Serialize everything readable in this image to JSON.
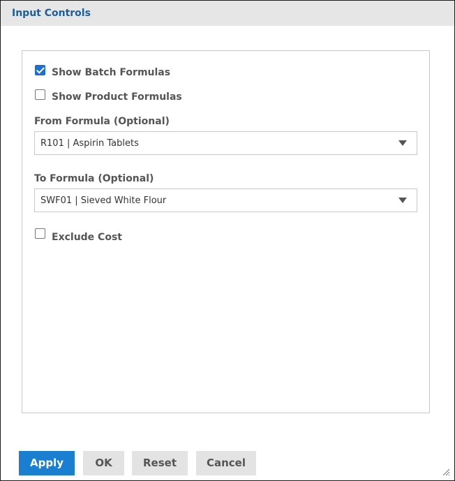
{
  "dialog": {
    "title": "Input Controls"
  },
  "controls": {
    "show_batch_formulas": {
      "label": "Show Batch Formulas",
      "checked": true
    },
    "show_product_formulas": {
      "label": "Show Product Formulas",
      "checked": false
    },
    "from_formula": {
      "label": "From Formula (Optional)",
      "value": "R101 | Aspirin Tablets"
    },
    "to_formula": {
      "label": "To Formula (Optional)",
      "value": "SWF01 | Sieved White Flour"
    },
    "exclude_cost": {
      "label": "Exclude Cost",
      "checked": false
    }
  },
  "buttons": {
    "apply": "Apply",
    "ok": "OK",
    "reset": "Reset",
    "cancel": "Cancel"
  },
  "colors": {
    "title": "#1a5fa0",
    "primary_button": "#1a7fd1",
    "secondary_button": "#e3e3e3"
  },
  "icons": {
    "dropdown": "chevron-down-icon",
    "resize": "resize-grip-icon"
  }
}
